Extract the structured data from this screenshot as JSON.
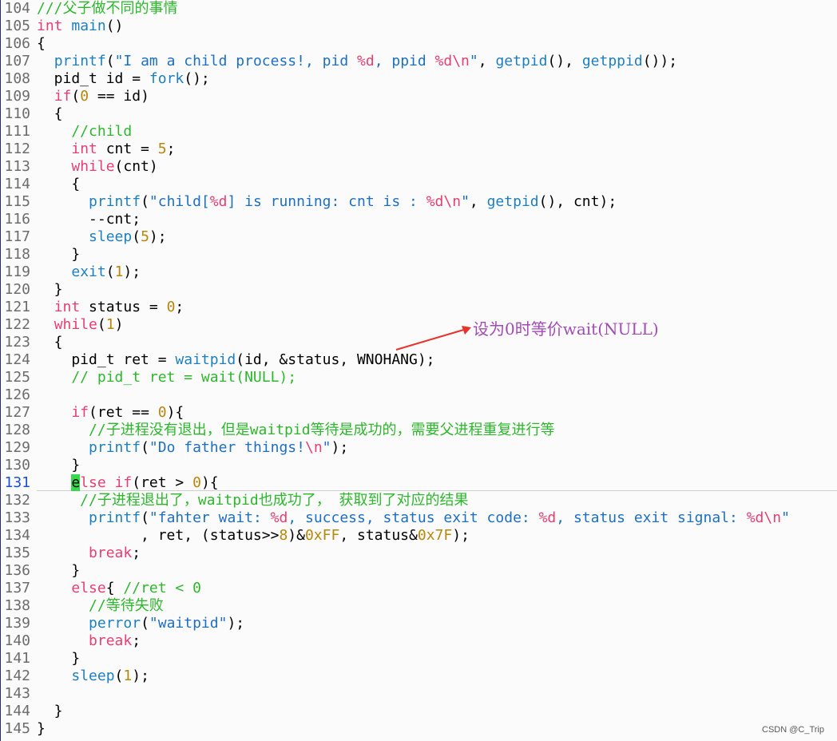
{
  "editor": {
    "current_line": 131,
    "lines": [
      {
        "num": "104",
        "segments": [
          {
            "t": "///父子做不同的事情",
            "c": "c"
          }
        ]
      },
      {
        "num": "105",
        "segments": [
          {
            "t": "int ",
            "c": "k"
          },
          {
            "t": "main",
            "c": "f"
          },
          {
            "t": "()",
            "c": "p"
          }
        ]
      },
      {
        "num": "106",
        "segments": [
          {
            "t": "{",
            "c": "p"
          }
        ]
      },
      {
        "num": "107",
        "segments": [
          {
            "t": "  ",
            "c": "p"
          },
          {
            "t": "printf",
            "c": "f"
          },
          {
            "t": "(",
            "c": "p"
          },
          {
            "t": "\"I am a child process!, pid ",
            "c": "s"
          },
          {
            "t": "%d",
            "c": "e"
          },
          {
            "t": ", ppid ",
            "c": "s"
          },
          {
            "t": "%d\\n",
            "c": "e"
          },
          {
            "t": "\"",
            "c": "s"
          },
          {
            "t": ", ",
            "c": "p"
          },
          {
            "t": "getpid",
            "c": "f"
          },
          {
            "t": "(), ",
            "c": "p"
          },
          {
            "t": "getppid",
            "c": "f"
          },
          {
            "t": "());",
            "c": "p"
          }
        ]
      },
      {
        "num": "108",
        "segments": [
          {
            "t": "  pid_t id = ",
            "c": "p"
          },
          {
            "t": "fork",
            "c": "f"
          },
          {
            "t": "();",
            "c": "p"
          }
        ]
      },
      {
        "num": "109",
        "segments": [
          {
            "t": "  ",
            "c": "p"
          },
          {
            "t": "if",
            "c": "k"
          },
          {
            "t": "(",
            "c": "p"
          },
          {
            "t": "0",
            "c": "n"
          },
          {
            "t": " == id)",
            "c": "p"
          }
        ]
      },
      {
        "num": "110",
        "segments": [
          {
            "t": "  {",
            "c": "p"
          }
        ]
      },
      {
        "num": "111",
        "segments": [
          {
            "t": "    //child",
            "c": "c"
          }
        ]
      },
      {
        "num": "112",
        "segments": [
          {
            "t": "    ",
            "c": "p"
          },
          {
            "t": "int",
            "c": "k"
          },
          {
            "t": " cnt = ",
            "c": "p"
          },
          {
            "t": "5",
            "c": "n"
          },
          {
            "t": ";",
            "c": "p"
          }
        ]
      },
      {
        "num": "113",
        "segments": [
          {
            "t": "    ",
            "c": "p"
          },
          {
            "t": "while",
            "c": "k"
          },
          {
            "t": "(cnt)",
            "c": "p"
          }
        ]
      },
      {
        "num": "114",
        "segments": [
          {
            "t": "    {",
            "c": "p"
          }
        ]
      },
      {
        "num": "115",
        "segments": [
          {
            "t": "      ",
            "c": "p"
          },
          {
            "t": "printf",
            "c": "f"
          },
          {
            "t": "(",
            "c": "p"
          },
          {
            "t": "\"child[",
            "c": "s"
          },
          {
            "t": "%d",
            "c": "e"
          },
          {
            "t": "] is running: cnt is : ",
            "c": "s"
          },
          {
            "t": "%d\\n",
            "c": "e"
          },
          {
            "t": "\"",
            "c": "s"
          },
          {
            "t": ", ",
            "c": "p"
          },
          {
            "t": "getpid",
            "c": "f"
          },
          {
            "t": "(), cnt);",
            "c": "p"
          }
        ]
      },
      {
        "num": "116",
        "segments": [
          {
            "t": "      --cnt;",
            "c": "p"
          }
        ]
      },
      {
        "num": "117",
        "segments": [
          {
            "t": "      ",
            "c": "p"
          },
          {
            "t": "sleep",
            "c": "f"
          },
          {
            "t": "(",
            "c": "p"
          },
          {
            "t": "5",
            "c": "n"
          },
          {
            "t": ");",
            "c": "p"
          }
        ]
      },
      {
        "num": "118",
        "segments": [
          {
            "t": "    }",
            "c": "p"
          }
        ]
      },
      {
        "num": "119",
        "segments": [
          {
            "t": "    ",
            "c": "p"
          },
          {
            "t": "exit",
            "c": "f"
          },
          {
            "t": "(",
            "c": "p"
          },
          {
            "t": "1",
            "c": "n"
          },
          {
            "t": ");",
            "c": "p"
          }
        ]
      },
      {
        "num": "120",
        "segments": [
          {
            "t": "  }",
            "c": "p"
          }
        ]
      },
      {
        "num": "121",
        "segments": [
          {
            "t": "  ",
            "c": "p"
          },
          {
            "t": "int",
            "c": "k"
          },
          {
            "t": " status = ",
            "c": "p"
          },
          {
            "t": "0",
            "c": "n"
          },
          {
            "t": ";",
            "c": "p"
          }
        ]
      },
      {
        "num": "122",
        "segments": [
          {
            "t": "  ",
            "c": "p"
          },
          {
            "t": "while",
            "c": "k"
          },
          {
            "t": "(",
            "c": "p"
          },
          {
            "t": "1",
            "c": "n"
          },
          {
            "t": ")",
            "c": "p"
          }
        ]
      },
      {
        "num": "123",
        "segments": [
          {
            "t": "  {",
            "c": "p"
          }
        ]
      },
      {
        "num": "124",
        "segments": [
          {
            "t": "    pid_t ret = ",
            "c": "p"
          },
          {
            "t": "waitpid",
            "c": "f"
          },
          {
            "t": "(id, &status, WNOHANG);",
            "c": "p"
          }
        ]
      },
      {
        "num": "125",
        "segments": [
          {
            "t": "    // pid_t ret = wait(NULL);",
            "c": "c"
          }
        ]
      },
      {
        "num": "126",
        "segments": []
      },
      {
        "num": "127",
        "segments": [
          {
            "t": "    ",
            "c": "p"
          },
          {
            "t": "if",
            "c": "k"
          },
          {
            "t": "(ret == ",
            "c": "p"
          },
          {
            "t": "0",
            "c": "n"
          },
          {
            "t": "){",
            "c": "p"
          }
        ]
      },
      {
        "num": "128",
        "segments": [
          {
            "t": "      //子进程没有退出，但是",
            "c": "c"
          },
          {
            "t": "waitpid",
            "c": "c"
          },
          {
            "t": "等待是成功的，需要父进程重复进行等",
            "c": "c"
          }
        ]
      },
      {
        "num": "129",
        "segments": [
          {
            "t": "      ",
            "c": "p"
          },
          {
            "t": "printf",
            "c": "f"
          },
          {
            "t": "(",
            "c": "p"
          },
          {
            "t": "\"Do father things!",
            "c": "s"
          },
          {
            "t": "\\n",
            "c": "e"
          },
          {
            "t": "\"",
            "c": "s"
          },
          {
            "t": ");",
            "c": "p"
          }
        ]
      },
      {
        "num": "130",
        "segments": [
          {
            "t": "    }",
            "c": "p"
          }
        ]
      },
      {
        "num": "131",
        "segments": [
          {
            "t": "    ",
            "c": "p"
          },
          {
            "t": "e",
            "c": "cursor"
          },
          {
            "t": "lse ",
            "c": "k"
          },
          {
            "t": "if",
            "c": "k"
          },
          {
            "t": "(ret > ",
            "c": "p"
          },
          {
            "t": "0",
            "c": "n"
          },
          {
            "t": "){",
            "c": "p"
          }
        ]
      },
      {
        "num": "132",
        "segments": [
          {
            "t": "     //子进程退出了，",
            "c": "c"
          },
          {
            "t": "waitpid",
            "c": "c"
          },
          {
            "t": "也成功了， 获取到了对应的结果",
            "c": "c"
          }
        ]
      },
      {
        "num": "133",
        "segments": [
          {
            "t": "      ",
            "c": "p"
          },
          {
            "t": "printf",
            "c": "f"
          },
          {
            "t": "(",
            "c": "p"
          },
          {
            "t": "\"fahter wait: ",
            "c": "s"
          },
          {
            "t": "%d",
            "c": "e"
          },
          {
            "t": ", success, status exit code: ",
            "c": "s"
          },
          {
            "t": "%d",
            "c": "e"
          },
          {
            "t": ", status exit signal: ",
            "c": "s"
          },
          {
            "t": "%d\\n",
            "c": "e"
          },
          {
            "t": "\"",
            "c": "s"
          }
        ]
      },
      {
        "num": "134",
        "segments": [
          {
            "t": "            , ret, (status>>",
            "c": "p"
          },
          {
            "t": "8",
            "c": "n"
          },
          {
            "t": ")&",
            "c": "p"
          },
          {
            "t": "0xFF",
            "c": "n"
          },
          {
            "t": ", status&",
            "c": "p"
          },
          {
            "t": "0x7F",
            "c": "n"
          },
          {
            "t": ");",
            "c": "p"
          }
        ]
      },
      {
        "num": "135",
        "segments": [
          {
            "t": "      ",
            "c": "p"
          },
          {
            "t": "break",
            "c": "k"
          },
          {
            "t": ";",
            "c": "p"
          }
        ]
      },
      {
        "num": "136",
        "segments": [
          {
            "t": "    }",
            "c": "p"
          }
        ]
      },
      {
        "num": "137",
        "segments": [
          {
            "t": "    ",
            "c": "p"
          },
          {
            "t": "else",
            "c": "k"
          },
          {
            "t": "{ ",
            "c": "p"
          },
          {
            "t": "//ret < 0",
            "c": "c"
          }
        ]
      },
      {
        "num": "138",
        "segments": [
          {
            "t": "      //等待失败",
            "c": "c"
          }
        ]
      },
      {
        "num": "139",
        "segments": [
          {
            "t": "      ",
            "c": "p"
          },
          {
            "t": "perror",
            "c": "f"
          },
          {
            "t": "(",
            "c": "p"
          },
          {
            "t": "\"waitpid\"",
            "c": "s"
          },
          {
            "t": ");",
            "c": "p"
          }
        ]
      },
      {
        "num": "140",
        "segments": [
          {
            "t": "      ",
            "c": "p"
          },
          {
            "t": "break",
            "c": "k"
          },
          {
            "t": ";",
            "c": "p"
          }
        ]
      },
      {
        "num": "141",
        "segments": [
          {
            "t": "    }",
            "c": "p"
          }
        ]
      },
      {
        "num": "142",
        "segments": [
          {
            "t": "    ",
            "c": "p"
          },
          {
            "t": "sleep",
            "c": "f"
          },
          {
            "t": "(",
            "c": "p"
          },
          {
            "t": "1",
            "c": "n"
          },
          {
            "t": ");",
            "c": "p"
          }
        ]
      },
      {
        "num": "143",
        "segments": []
      },
      {
        "num": "144",
        "segments": [
          {
            "t": "  }",
            "c": "p"
          }
        ]
      },
      {
        "num": "145",
        "segments": [
          {
            "t": "}",
            "c": "p"
          }
        ]
      }
    ]
  },
  "annotation": {
    "text": "设为0时等价wait(NULL)",
    "color": "#a24bb5",
    "arrow_color": "#e8322a"
  },
  "watermark": "CSDN @C_Trip",
  "colors": {
    "keyword": "#e83f72",
    "function": "#1e7fc0",
    "string": "#1e6fc0",
    "number": "#b8860b",
    "comment": "#2db72d",
    "cursor": "#36d94b",
    "current_line_number": "#1e4fd6"
  }
}
